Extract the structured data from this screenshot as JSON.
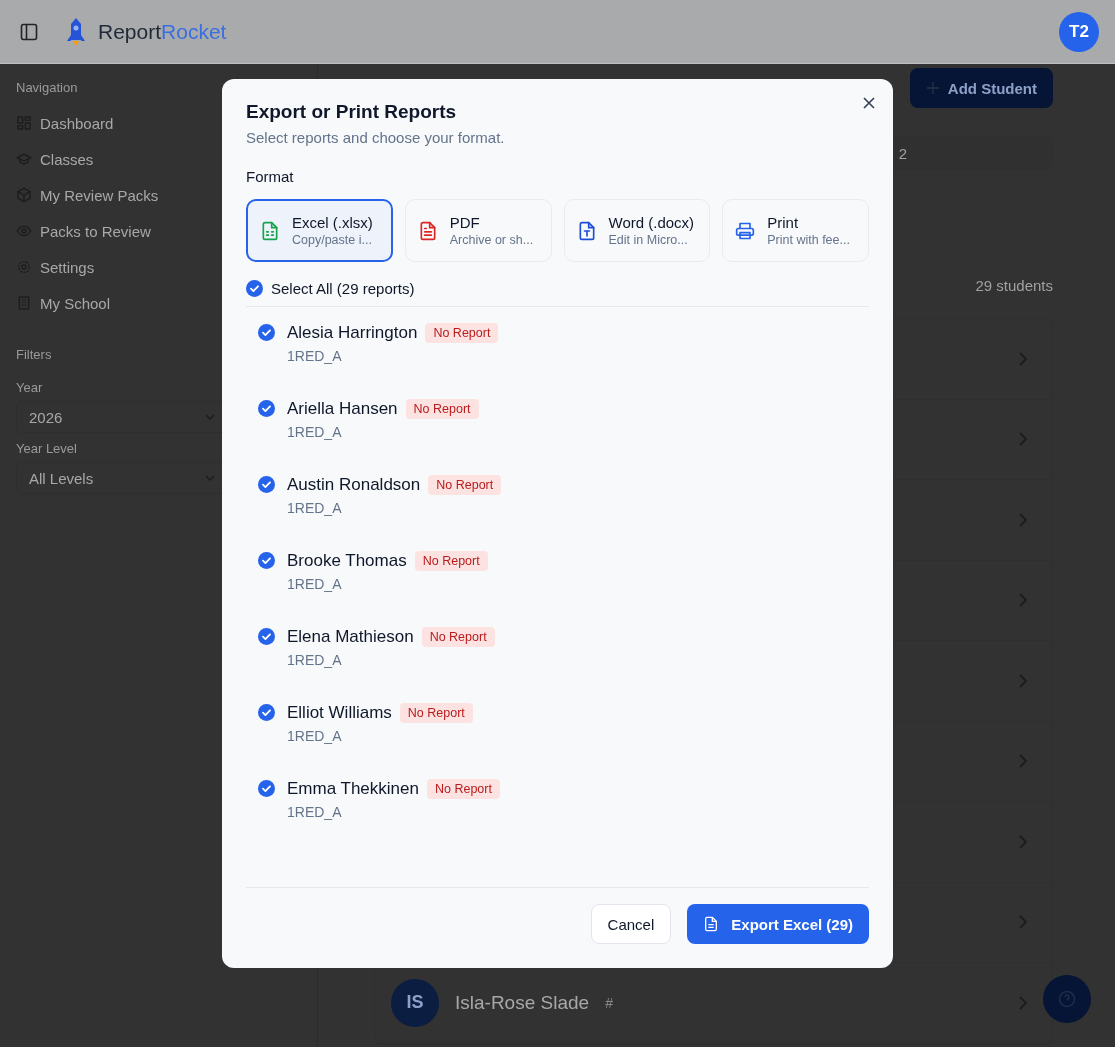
{
  "header": {
    "logo_dark": "Report",
    "logo_accent": "Rocket",
    "avatar": "T2"
  },
  "sidebar": {
    "nav_title": "Navigation",
    "items": [
      {
        "label": "Dashboard",
        "kind": "grid"
      },
      {
        "label": "Classes",
        "kind": "cap"
      },
      {
        "label": "My Review Packs",
        "kind": "box"
      },
      {
        "label": "Packs to Review",
        "kind": "eye"
      },
      {
        "label": "Settings",
        "kind": "gear"
      },
      {
        "label": "My School",
        "kind": "building"
      }
    ],
    "filters_title": "Filters",
    "filters": [
      {
        "label": "Year",
        "value": "2026"
      },
      {
        "label": "Year Level",
        "value": "All Levels"
      }
    ]
  },
  "main": {
    "add_button": "Add Student",
    "tab_fragment": "2",
    "count": "29 students",
    "students": [
      {
        "initials": "IS",
        "name": "Isla-Rose Slade",
        "mark": "#"
      }
    ]
  },
  "dialog": {
    "title": "Export or Print Reports",
    "subtitle": "Select reports and choose your format.",
    "format_label": "Format",
    "formats": [
      {
        "kind": "excel",
        "label": "Excel (.xlsx)",
        "desc": "Copy/paste i...",
        "selected": true
      },
      {
        "kind": "pdf",
        "label": "PDF",
        "desc": "Archive or sh...",
        "selected": false
      },
      {
        "kind": "word",
        "label": "Word (.docx)",
        "desc": "Edit in Micro...",
        "selected": false
      },
      {
        "kind": "print",
        "label": "Print",
        "desc": "Print with fee...",
        "selected": false
      }
    ],
    "select_all": {
      "label": "Select All (29 reports)",
      "checked": true
    },
    "reports": [
      {
        "name": "Alesia Harrington",
        "badge": "No Report",
        "class": "1RED_A",
        "checked": true
      },
      {
        "name": "Ariella Hansen",
        "badge": "No Report",
        "class": "1RED_A",
        "checked": true
      },
      {
        "name": "Austin Ronaldson",
        "badge": "No Report",
        "class": "1RED_A",
        "checked": true
      },
      {
        "name": "Brooke Thomas",
        "badge": "No Report",
        "class": "1RED_A",
        "checked": true
      },
      {
        "name": "Elena Mathieson",
        "badge": "No Report",
        "class": "1RED_A",
        "checked": true
      },
      {
        "name": "Elliot Williams",
        "badge": "No Report",
        "class": "1RED_A",
        "checked": true
      },
      {
        "name": "Emma Thekkinen",
        "badge": "No Report",
        "class": "1RED_A",
        "checked": true
      }
    ],
    "cancel": "Cancel",
    "export": "Export Excel (29)"
  }
}
